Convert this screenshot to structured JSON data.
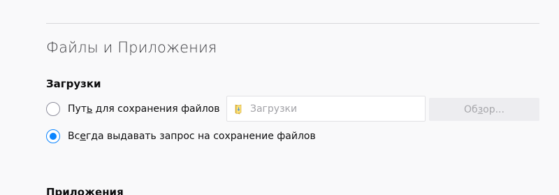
{
  "section": {
    "title": "Файлы и Приложения"
  },
  "downloads": {
    "group_title": "Загрузки",
    "save_path": {
      "label_pre": "Пут",
      "label_accel": "ь",
      "label_post": " для сохранения файлов",
      "checked": false
    },
    "path_field": {
      "value": "Загрузки",
      "icon": "folder-icon"
    },
    "browse_button": {
      "label_pre": "Об",
      "label_accel": "з",
      "label_post": "ор...",
      "disabled": true
    },
    "always_ask": {
      "label_pre": "Вс",
      "label_accel": "е",
      "label_post": "гда выдавать запрос на сохранение файлов",
      "checked": true
    }
  },
  "applications": {
    "group_title": "Приложения"
  },
  "colors": {
    "accent": "#0a84ff",
    "background": "#f9f9fa"
  }
}
